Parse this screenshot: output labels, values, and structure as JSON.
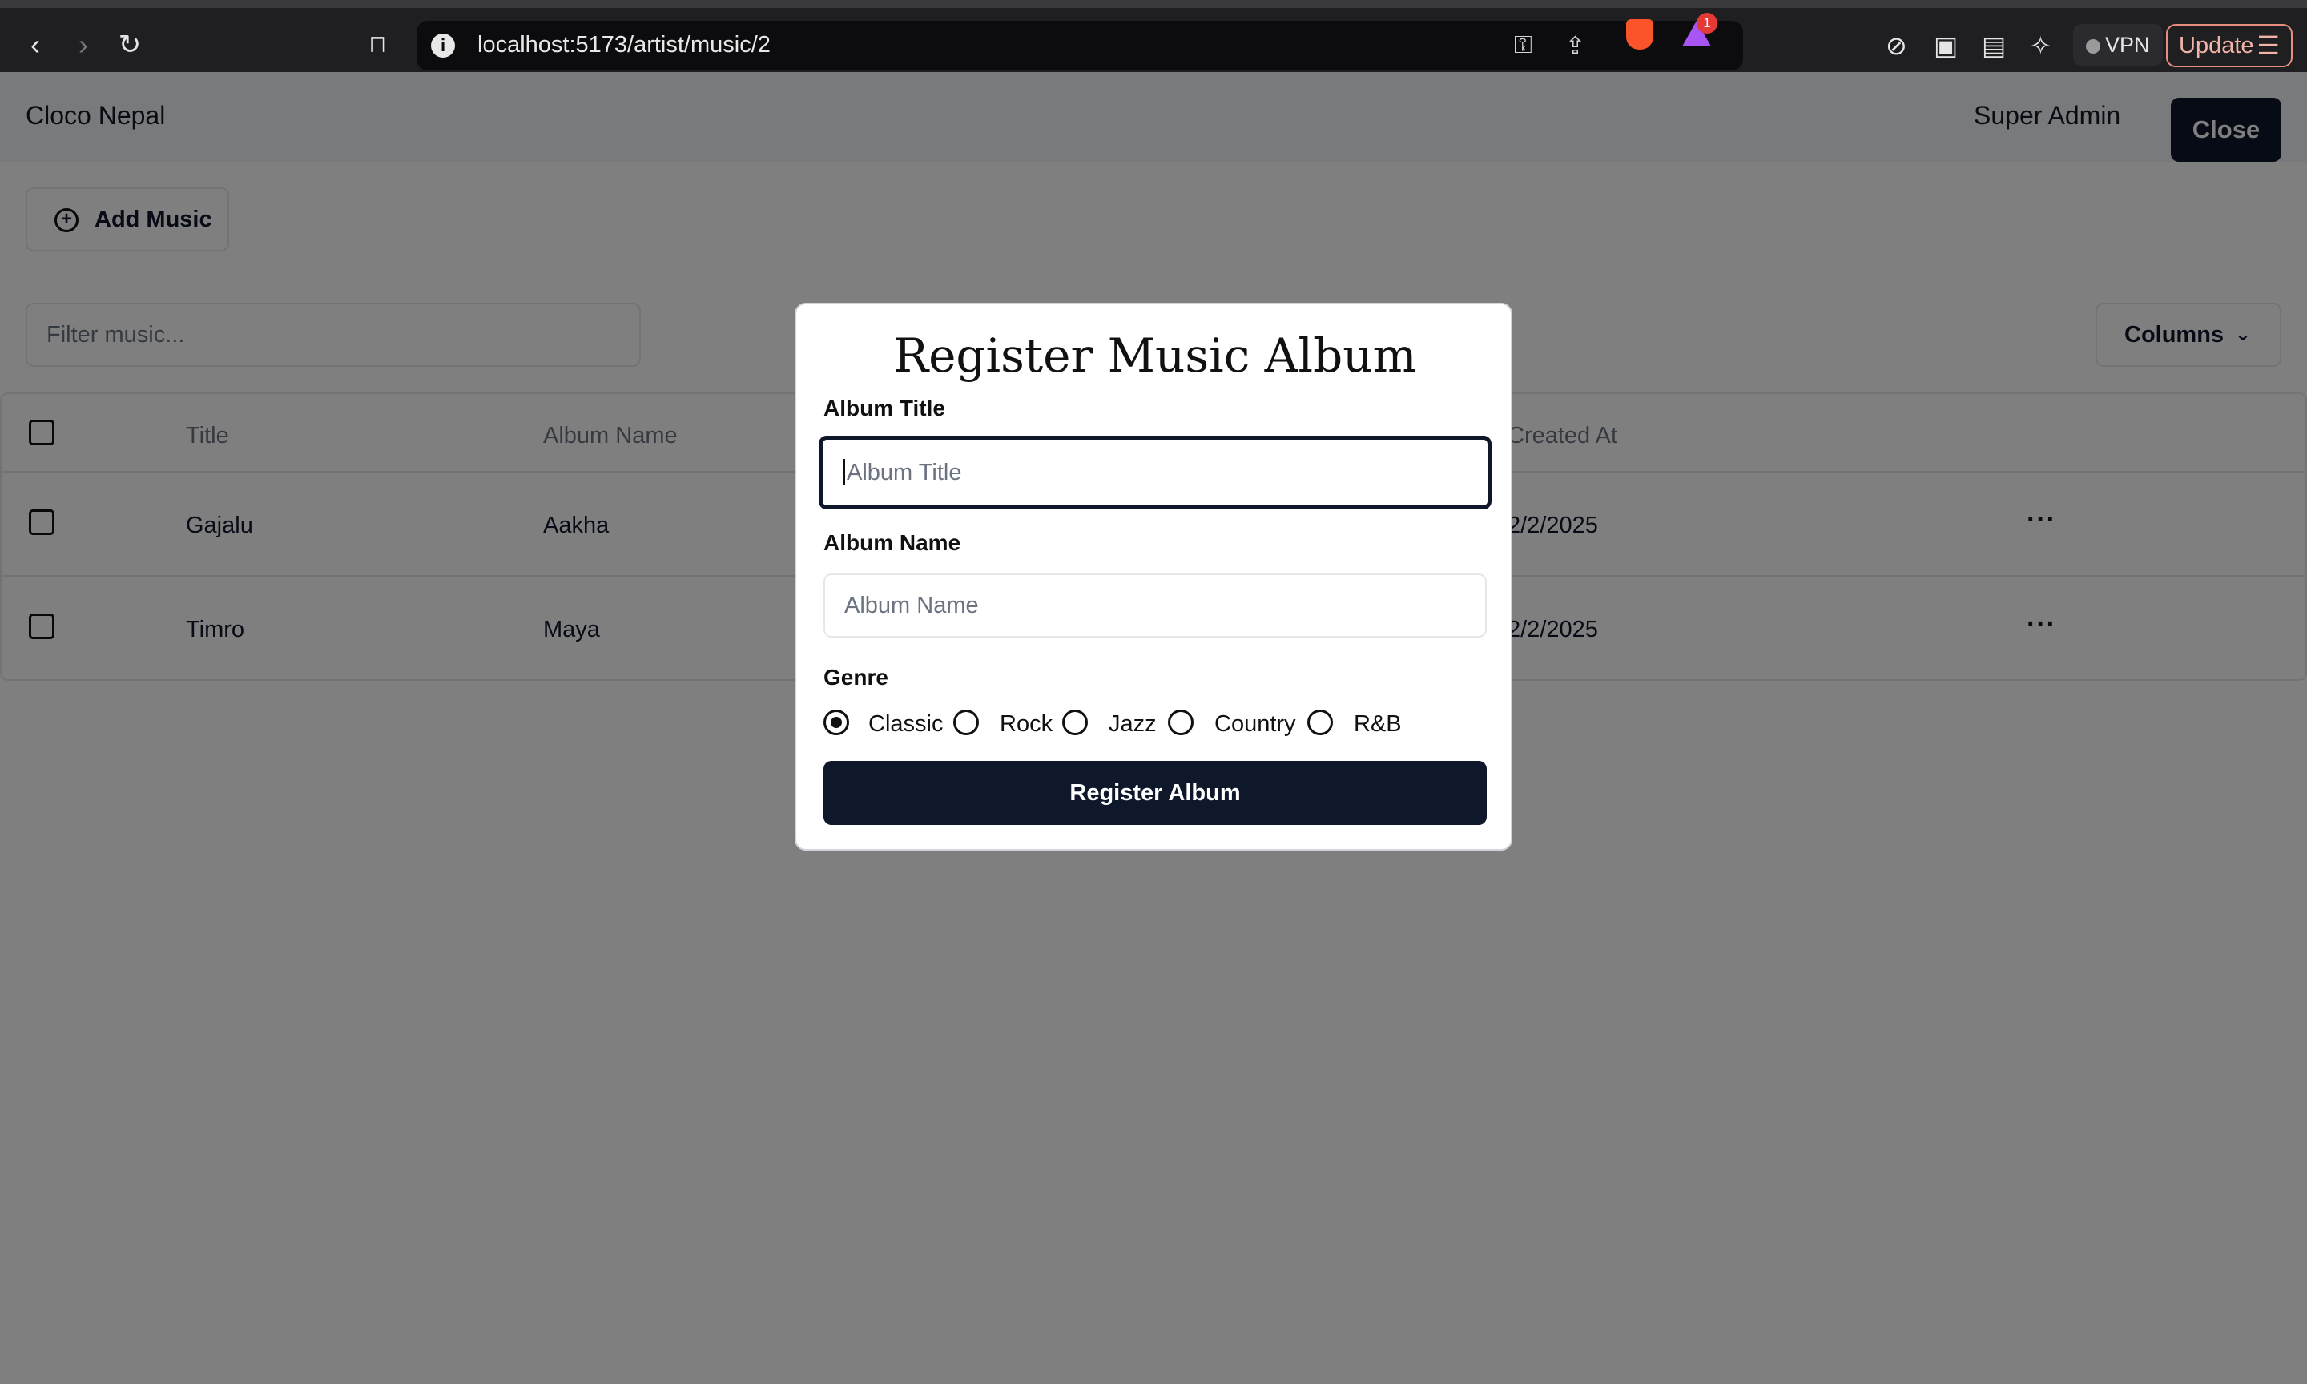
{
  "browser": {
    "url": "localhost:5173/artist/music/2",
    "info_glyph": "i",
    "rewards_badge": "1",
    "vpn_label": "VPN",
    "update_label": "Update"
  },
  "header": {
    "brand": "Cloco Nepal",
    "user": "Super Admin",
    "close_label": "Close"
  },
  "toolbar": {
    "add_music_label": "Add Music",
    "filter_placeholder": "Filter music...",
    "columns_label": "Columns"
  },
  "table": {
    "headers": [
      "Title",
      "Album Name",
      "Created At"
    ],
    "rows": [
      {
        "title": "Gajalu",
        "album": "Aakha",
        "created": "2/2/2025"
      },
      {
        "title": "Timro",
        "album": "Maya",
        "created": "2/2/2025"
      }
    ],
    "row_action_glyph": "···"
  },
  "modal": {
    "title": "Register Music Album",
    "album_title_label": "Album Title",
    "album_title_placeholder": "Album Title",
    "album_name_label": "Album Name",
    "album_name_placeholder": "Album Name",
    "genre_label": "Genre",
    "genres": [
      "Classic",
      "Rock",
      "Jazz",
      "Country",
      "R&B"
    ],
    "selected_genre": "Classic",
    "submit_label": "Register Album"
  },
  "colors": {
    "primary": "#0f172a",
    "overlay": "rgba(0,0,0,0.5)",
    "update_accent": "#e98d7e"
  }
}
